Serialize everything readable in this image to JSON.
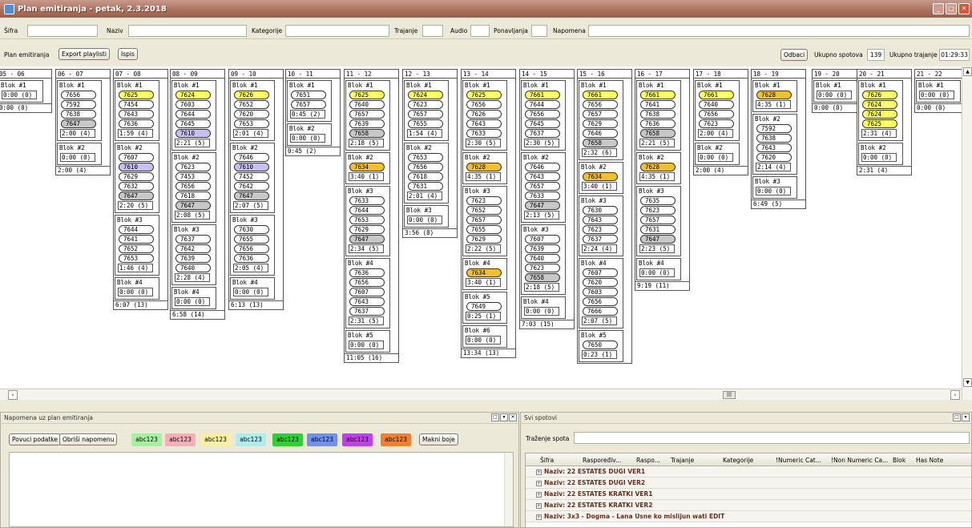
{
  "window": {
    "title": "Plan emitiranja - petak, 2.3.2018"
  },
  "filters": {
    "sifra": "Šifra",
    "naziv": "Naziv",
    "kategorije": "Kategorije",
    "trajanje": "Trajanje",
    "audio": "Audio",
    "ponavljanja": "Ponavljanja",
    "napomena": "Napomena"
  },
  "toolbar": {
    "label": "Plan emitiranja",
    "export": "Export playlisti",
    "ispis": "Ispis",
    "odbaci": "Odbaci",
    "ukupno_spotova_label": "Ukupno spotova",
    "ukupno_spotova": "139",
    "ukupno_trajanje_label": "Ukupno trajanje",
    "ukupno_trajanje": "01:29:33"
  },
  "colors": {
    "yellow": "#ffff66",
    "orange": "#f0c030",
    "gray": "#c8c8c8",
    "lavender": "#c8c0f0"
  },
  "hours": [
    {
      "label": "05 - 06",
      "blocks": [
        {
          "name": "Blok #1",
          "spots": [],
          "total": "0:00 (0)"
        }
      ],
      "total": "0:00 (0)"
    },
    {
      "label": "06 - 07",
      "blocks": [
        {
          "name": "Blok #1",
          "spots": [
            {
              "code": "7656"
            },
            {
              "code": "7592"
            },
            {
              "code": "7638"
            },
            {
              "code": "7647",
              "color": "gray"
            }
          ],
          "total": "2:00 (4)"
        },
        {
          "name": "Blok #2",
          "spots": [],
          "total": "0:00 (0)"
        }
      ],
      "total": "2:00 (4)"
    },
    {
      "label": "07 - 08",
      "blocks": [
        {
          "name": "Blok #1",
          "spots": [
            {
              "code": "7625",
              "color": "yellow"
            },
            {
              "code": "7454"
            },
            {
              "code": "7643"
            },
            {
              "code": "7636"
            }
          ],
          "total": "1:59 (4)"
        },
        {
          "name": "Blok #2",
          "spots": [
            {
              "code": "7607"
            },
            {
              "code": "7610",
              "color": "lav"
            },
            {
              "code": "7629"
            },
            {
              "code": "7632"
            },
            {
              "code": "7647",
              "color": "gray"
            }
          ],
          "total": "2:20 (5)"
        },
        {
          "name": "Blok #3",
          "spots": [
            {
              "code": "7644"
            },
            {
              "code": "7641"
            },
            {
              "code": "7652"
            },
            {
              "code": "7653"
            }
          ],
          "total": "1:46 (4)"
        },
        {
          "name": "Blok #4",
          "spots": [],
          "total": "0:00 (0)"
        }
      ],
      "total": "6:07 (13)"
    },
    {
      "label": "08 - 09",
      "blocks": [
        {
          "name": "Blok #1",
          "spots": [
            {
              "code": "7624",
              "color": "yellow"
            },
            {
              "code": "7603"
            },
            {
              "code": "7644"
            },
            {
              "code": "7645"
            },
            {
              "code": "7610",
              "color": "lav"
            }
          ],
          "total": "2:21 (5)"
        },
        {
          "name": "Blok #2",
          "spots": [
            {
              "code": "7623"
            },
            {
              "code": "7453"
            },
            {
              "code": "7656"
            },
            {
              "code": "7618"
            },
            {
              "code": "7647",
              "color": "gray"
            }
          ],
          "total": "2:08 (5)"
        },
        {
          "name": "Blok #3",
          "spots": [
            {
              "code": "7637"
            },
            {
              "code": "7642"
            },
            {
              "code": "7639"
            },
            {
              "code": "7640"
            }
          ],
          "total": "2:28 (4)"
        },
        {
          "name": "Blok #4",
          "spots": [],
          "total": "0:00 (0)"
        }
      ],
      "total": "6:58 (14)"
    },
    {
      "label": "09 - 10",
      "blocks": [
        {
          "name": "Blok #1",
          "spots": [
            {
              "code": "7626",
              "color": "yellow"
            },
            {
              "code": "7652"
            },
            {
              "code": "7620"
            },
            {
              "code": "7653"
            }
          ],
          "total": "2:01 (4)"
        },
        {
          "name": "Blok #2",
          "spots": [
            {
              "code": "7646"
            },
            {
              "code": "7610",
              "color": "lav"
            },
            {
              "code": "7452"
            },
            {
              "code": "7642"
            },
            {
              "code": "7647",
              "color": "gray"
            }
          ],
          "total": "2:07 (5)"
        },
        {
          "name": "Blok #3",
          "spots": [
            {
              "code": "7630"
            },
            {
              "code": "7655"
            },
            {
              "code": "7656"
            },
            {
              "code": "7636"
            }
          ],
          "total": "2:05 (4)"
        },
        {
          "name": "Blok #4",
          "spots": [],
          "total": "0:00 (0)"
        }
      ],
      "total": "6:13 (13)"
    },
    {
      "label": "10 - 11",
      "blocks": [
        {
          "name": "Blok #1",
          "spots": [
            {
              "code": "7651"
            },
            {
              "code": "7657"
            }
          ],
          "total": "0:45 (2)"
        },
        {
          "name": "Blok #2",
          "spots": [],
          "total": "0:00 (0)"
        }
      ],
      "total": "0:45 (2)"
    },
    {
      "label": "11 - 12",
      "blocks": [
        {
          "name": "Blok #1",
          "spots": [
            {
              "code": "7625",
              "color": "yellow"
            },
            {
              "code": "7640"
            },
            {
              "code": "7657"
            },
            {
              "code": "7639"
            },
            {
              "code": "7658",
              "color": "gray"
            }
          ],
          "total": "2:18 (5)"
        },
        {
          "name": "Blok #2",
          "spots": [
            {
              "code": "7634",
              "color": "orange"
            }
          ],
          "total": "3:40 (1)"
        },
        {
          "name": "Blok #3",
          "spots": [
            {
              "code": "7633"
            },
            {
              "code": "7644"
            },
            {
              "code": "7653"
            },
            {
              "code": "7629"
            },
            {
              "code": "7647",
              "color": "gray"
            }
          ],
          "total": "2:34 (5)"
        },
        {
          "name": "Blok #4",
          "spots": [
            {
              "code": "7636"
            },
            {
              "code": "7656"
            },
            {
              "code": "7607"
            },
            {
              "code": "7643"
            },
            {
              "code": "7637"
            }
          ],
          "total": "2:31 (5)"
        },
        {
          "name": "Blok #5",
          "spots": [],
          "total": "0:00 (0)"
        }
      ],
      "total": "11:05 (16)"
    },
    {
      "label": "12 - 13",
      "blocks": [
        {
          "name": "Blok #1",
          "spots": [
            {
              "code": "7624",
              "color": "yellow"
            },
            {
              "code": "7623"
            },
            {
              "code": "7657"
            },
            {
              "code": "7655"
            }
          ],
          "total": "1:54 (4)"
        },
        {
          "name": "Blok #2",
          "spots": [
            {
              "code": "7653"
            },
            {
              "code": "7656"
            },
            {
              "code": "7618"
            },
            {
              "code": "7631"
            }
          ],
          "total": "2:01 (4)"
        },
        {
          "name": "Blok #3",
          "spots": [],
          "total": "0:00 (0)"
        }
      ],
      "total": "3:56 (8)"
    },
    {
      "label": "13 - 14",
      "blocks": [
        {
          "name": "Blok #1",
          "spots": [
            {
              "code": "7625",
              "color": "yellow"
            },
            {
              "code": "7656"
            },
            {
              "code": "7626"
            },
            {
              "code": "7643"
            },
            {
              "code": "7633"
            }
          ],
          "total": "2:30 (5)"
        },
        {
          "name": "Blok #2",
          "spots": [
            {
              "code": "7628",
              "color": "orange"
            }
          ],
          "total": "4:35 (1)"
        },
        {
          "name": "Blok #3",
          "spots": [
            {
              "code": "7623"
            },
            {
              "code": "7652"
            },
            {
              "code": "7657"
            },
            {
              "code": "7655"
            },
            {
              "code": "7629"
            }
          ],
          "total": "2:22 (5)"
        },
        {
          "name": "Blok #4",
          "spots": [
            {
              "code": "7634",
              "color": "orange"
            }
          ],
          "total": "3:40 (1)"
        },
        {
          "name": "Blok #5",
          "spots": [
            {
              "code": "7649"
            }
          ],
          "total": "0:25 (1)"
        },
        {
          "name": "Blok #6",
          "spots": [],
          "total": "0:00 (0)"
        }
      ],
      "total": "13:34 (13)"
    },
    {
      "label": "14 - 15",
      "blocks": [
        {
          "name": "Blok #1",
          "spots": [
            {
              "code": "7661",
              "color": "yellow"
            },
            {
              "code": "7644"
            },
            {
              "code": "7656"
            },
            {
              "code": "7645"
            },
            {
              "code": "7637"
            }
          ],
          "total": "2:30 (5)"
        },
        {
          "name": "Blok #2",
          "spots": [
            {
              "code": "7646"
            },
            {
              "code": "7643"
            },
            {
              "code": "7657"
            },
            {
              "code": "7633"
            },
            {
              "code": "7647",
              "color": "gray"
            }
          ],
          "total": "2:13 (5)"
        },
        {
          "name": "Blok #3",
          "spots": [
            {
              "code": "7607"
            },
            {
              "code": "7639"
            },
            {
              "code": "7640"
            },
            {
              "code": "7623"
            },
            {
              "code": "7658",
              "color": "gray"
            }
          ],
          "total": "2:18 (5)"
        },
        {
          "name": "Blok #4",
          "spots": [],
          "total": "0:00 (0)"
        }
      ],
      "total": "7:03 (15)"
    },
    {
      "label": "15 - 16",
      "blocks": [
        {
          "name": "Blok #1",
          "spots": [
            {
              "code": "7661",
              "color": "yellow"
            },
            {
              "code": "7656"
            },
            {
              "code": "7657"
            },
            {
              "code": "7629"
            },
            {
              "code": "7646"
            },
            {
              "code": "7658",
              "color": "gray"
            }
          ],
          "total": "2:32 (6)"
        },
        {
          "name": "Blok #2",
          "spots": [
            {
              "code": "7634",
              "color": "orange"
            }
          ],
          "total": "3:40 (1)"
        },
        {
          "name": "Blok #3",
          "spots": [
            {
              "code": "7630"
            },
            {
              "code": "7643"
            },
            {
              "code": "7623"
            },
            {
              "code": "7637"
            }
          ],
          "total": "2:24 (4)"
        },
        {
          "name": "Blok #4",
          "spots": [
            {
              "code": "7607"
            },
            {
              "code": "7620"
            },
            {
              "code": "7603"
            },
            {
              "code": "7656"
            },
            {
              "code": "7666"
            }
          ],
          "total": "2:07 (5)"
        },
        {
          "name": "Blok #5",
          "spots": [
            {
              "code": "7650"
            }
          ],
          "total": "0:23 (1)"
        }
      ],
      "total": ""
    },
    {
      "label": "16 - 17",
      "blocks": [
        {
          "name": "Blok #1",
          "spots": [
            {
              "code": "7661",
              "color": "yellow"
            },
            {
              "code": "7641"
            },
            {
              "code": "7638"
            },
            {
              "code": "7636"
            },
            {
              "code": "7658",
              "color": "gray"
            }
          ],
          "total": "2:21 (5)"
        },
        {
          "name": "Blok #2",
          "spots": [
            {
              "code": "7628",
              "color": "orange"
            }
          ],
          "total": "4:35 (1)"
        },
        {
          "name": "Blok #3",
          "spots": [
            {
              "code": "7635"
            },
            {
              "code": "7623"
            },
            {
              "code": "7657"
            },
            {
              "code": "7631"
            },
            {
              "code": "7647",
              "color": "gray"
            }
          ],
          "total": "2:23 (5)"
        },
        {
          "name": "Blok #4",
          "spots": [],
          "total": "0:00 (0)"
        }
      ],
      "total": "9:19 (11)"
    },
    {
      "label": "17 - 18",
      "blocks": [
        {
          "name": "Blok #1",
          "spots": [
            {
              "code": "7661",
              "color": "yellow"
            },
            {
              "code": "7640"
            },
            {
              "code": "7656"
            },
            {
              "code": "7623"
            }
          ],
          "total": "2:00 (4)"
        },
        {
          "name": "Blok #2",
          "spots": [],
          "total": "0:00 (0)"
        }
      ],
      "total": "2:00 (4)"
    },
    {
      "label": "18 - 19",
      "blocks": [
        {
          "name": "Blok #1",
          "spots": [
            {
              "code": "7628",
              "color": "orange"
            }
          ],
          "total": "4:35 (1)"
        },
        {
          "name": "Blok #2",
          "spots": [
            {
              "code": "7592"
            },
            {
              "code": "7638"
            },
            {
              "code": "7643"
            },
            {
              "code": "7620"
            }
          ],
          "total": "2:14 (4)"
        },
        {
          "name": "Blok #3",
          "spots": [],
          "total": "0:00 (0)"
        }
      ],
      "total": "6:49 (5)"
    },
    {
      "label": "19 - 20",
      "blocks": [
        {
          "name": "Blok #1",
          "spots": [],
          "total": "0:00 (0)"
        }
      ],
      "total": "0:00 (0)"
    },
    {
      "label": "20 - 21",
      "blocks": [
        {
          "name": "Blok #1",
          "spots": [
            {
              "code": "7626",
              "color": "yellow"
            },
            {
              "code": "7624",
              "color": "yellow"
            },
            {
              "code": "7624",
              "color": "yellow"
            },
            {
              "code": "7625",
              "color": "yellow"
            }
          ],
          "total": "2:31 (4)"
        },
        {
          "name": "Blok #2",
          "spots": [],
          "total": "0:00 (0)"
        }
      ],
      "total": "2:31 (4)"
    },
    {
      "label": "21 - 22",
      "blocks": [
        {
          "name": "Blok #1",
          "spots": [],
          "total": "0:00 (0)"
        }
      ],
      "total": "0:00 (0)"
    }
  ],
  "notes_panel": {
    "title": "Napomena uz plan emitiranja",
    "povuci": "Povuci podatke",
    "obrisi": "Obriši napomenu",
    "makni": "Makni boje"
  },
  "swatches": [
    {
      "text": "abc123",
      "color": "#a8f0a0"
    },
    {
      "text": "abc123",
      "color": "#f4b0b8"
    },
    {
      "text": "abc123",
      "color": "#f8f0a0"
    },
    {
      "text": "abc123",
      "color": "#b0ecec"
    },
    {
      "text": "abc123",
      "color": "#30d030"
    },
    {
      "text": "abc123",
      "color": "#7090f0"
    },
    {
      "text": "abc123",
      "color": "#c040f0"
    },
    {
      "text": "abc123",
      "color": "#f08030"
    }
  ],
  "spots_panel": {
    "title": "Svi spotovi",
    "search_label": "Traženje spota",
    "columns": [
      "Šifra",
      "Raspoređiv...",
      "Raspo...",
      "Trajanje",
      "Kategorije",
      "!Numeric Cat...",
      "!Non Numeric Ca...",
      "Blok",
      "Has Note"
    ],
    "rows": [
      "Naziv: 22 ESTATES DUGI VER1",
      "Naziv: 22 ESTATES DUGI VER2",
      "Naziv: 22 ESTATES KRATKI VER1",
      "Naziv: 22 ESTATES KRATKI VER2",
      "Naziv: 3x3 - Dogma - Lana Usne ko mislijun wati EDIT"
    ]
  }
}
